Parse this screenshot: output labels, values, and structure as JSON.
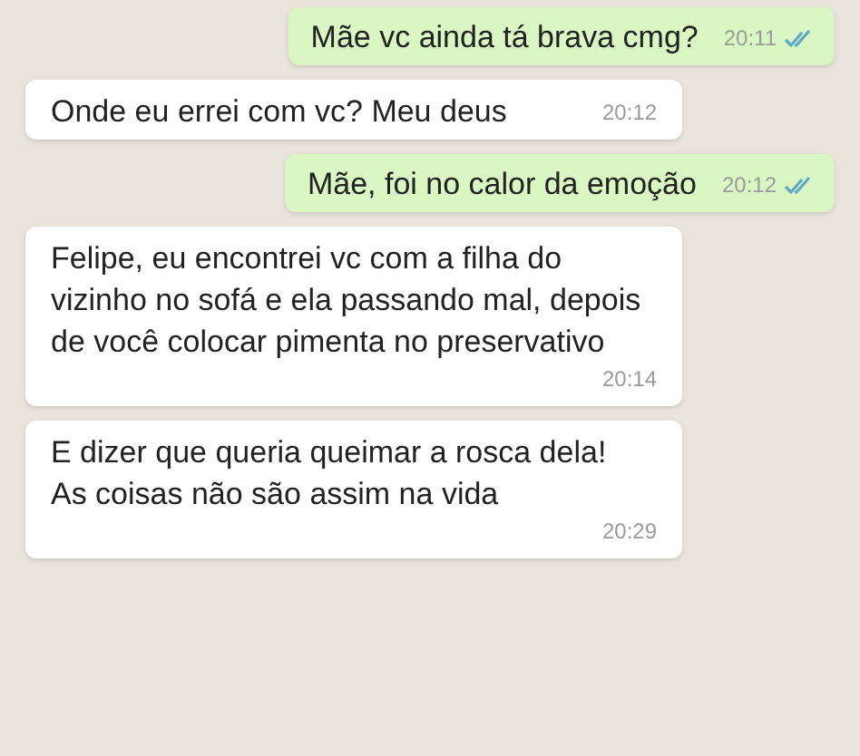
{
  "messages": [
    {
      "kind": "outgoing",
      "text": "Mãe vc ainda tá brava cmg?",
      "time": "20:11",
      "read": true
    },
    {
      "kind": "incoming",
      "text": "Onde eu errei com vc? Meu deus",
      "time": "20:12"
    },
    {
      "kind": "outgoing",
      "text": "Mãe, foi no calor da emoção",
      "time": "20:12",
      "read": true
    },
    {
      "kind": "incoming",
      "text": "Felipe, eu encontrei vc com a filha do vizinho no sofá e ela passando mal, depois de você colocar pimenta no preservativo",
      "time": "20:14"
    },
    {
      "kind": "incoming",
      "text": "E dizer que queria queimar a rosca dela!\nAs coisas não são assim na vida",
      "time": "20:29"
    }
  ]
}
